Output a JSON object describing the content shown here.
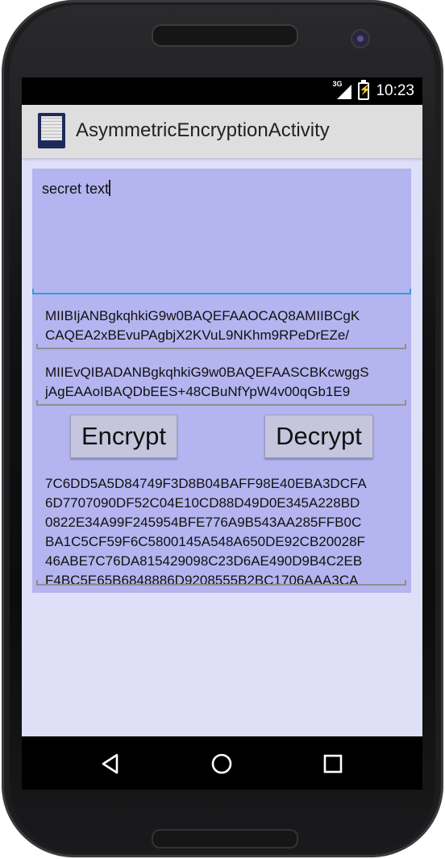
{
  "status_bar": {
    "network_label": "3G",
    "time": "10:23"
  },
  "action_bar": {
    "title": "AsymmetricEncryptionActivity",
    "icon": "app-document-icon"
  },
  "form": {
    "plain_text": "secret text",
    "public_key_lines": [
      "MIIBIjANBgkqhkiG9w0BAQEFAAOCAQ8AMIIBCgK",
      "CAQEA2xBEvuPAgbjX2KVuL9NKhm9RPeDrEZe/"
    ],
    "private_key_lines": [
      "MIIEvQIBADANBgkqhkiG9w0BAQEFAASCBKcwggS",
      "jAgEAAoIBAQDbEES+48CBuNfYpW4v00qGb1E9"
    ],
    "encrypt_label": "Encrypt",
    "decrypt_label": "Decrypt",
    "cipher_lines": [
      "7C6DD5A5D84749F3D8B04BAFF98E40EBA3DCFA",
      "6D7707090DF52C04E10CD88D49D0E345A228BD",
      "0822E34A99F245954BFE776A9B543AA285FFB0C",
      "BA1C5CF59F6C5800145A548A650DE92CB20028F",
      "46ABE7C76DA815429098C23D6AE490D9B4C2EB",
      "F4BC5E65B6848886D9208555B2BC1706AAA3CA"
    ]
  },
  "navigation": {
    "back": "back-icon",
    "home": "home-icon",
    "recents": "recents-icon"
  },
  "colors": {
    "screen_background": "#dfdff8",
    "content_background": "#b4b4f0",
    "focus_accent": "#2aa0dc",
    "action_bar": "#dedede",
    "button": "#c5c5dd"
  }
}
